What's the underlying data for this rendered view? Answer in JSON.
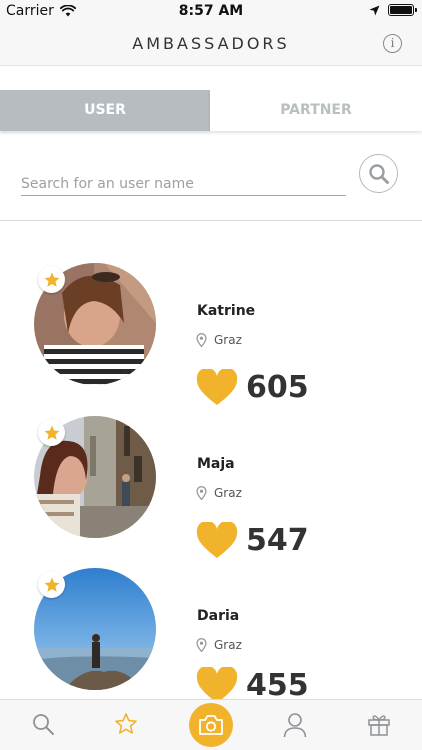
{
  "status_bar": {
    "carrier": "Carrier",
    "time": "8:57 AM"
  },
  "nav": {
    "title": "AMBASSADORS",
    "info_icon": "info-icon",
    "info_glyph": "i"
  },
  "tabs": [
    {
      "label": "USER",
      "active": true
    },
    {
      "label": "PARTNER",
      "active": false
    }
  ],
  "search": {
    "placeholder": "Search for an user name",
    "value": "",
    "icon": "search-icon"
  },
  "users": [
    {
      "name": "Katrine",
      "city": "Graz",
      "score": "605"
    },
    {
      "name": "Maja",
      "city": "Graz",
      "score": "547"
    },
    {
      "name": "Daria",
      "city": "Graz",
      "score": "455"
    }
  ],
  "tab_bar": {
    "items": [
      "search-icon",
      "star-icon",
      "camera-icon",
      "profile-icon",
      "gift-icon"
    ],
    "active": "star-icon"
  },
  "colors": {
    "accent": "#f2b32c",
    "tab_active_bg": "#b6bcbf",
    "text": "#333333"
  }
}
